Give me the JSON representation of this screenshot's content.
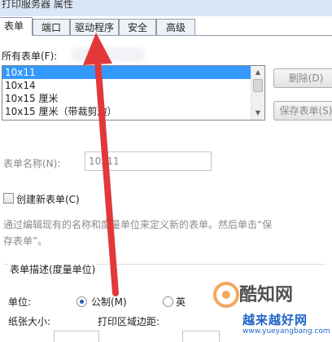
{
  "window": {
    "title": "打印服务器 属性"
  },
  "tabs": [
    {
      "label": "表单",
      "active": true
    },
    {
      "label": "端口"
    },
    {
      "label": "驱动程序"
    },
    {
      "label": "安全"
    },
    {
      "label": "高级"
    }
  ],
  "forms": {
    "list_label": "所有表单(F):",
    "items": [
      {
        "label": "10x11",
        "selected": true
      },
      {
        "label": "10x14"
      },
      {
        "label": "10x15 厘米"
      },
      {
        "label": "10x15 厘米（带裁剪边）"
      }
    ],
    "delete_button": "删除(D)",
    "save_button": "保存表单(S)"
  },
  "form_name": {
    "label": "表单名称(N):",
    "value": "10x11"
  },
  "create_new": {
    "label": "创建新表单(C)",
    "checked": false
  },
  "description": "通过编辑现有的名称和度量单位来定义新的表单。然后单击“保存表单”。",
  "measurements": {
    "title": "表单描述(度量单位)",
    "units_label": "单位:",
    "metric_label": "公制(M)",
    "english_label": "英",
    "paper_size_label": "纸张大小:",
    "margins_label": "打印区域边距:"
  },
  "watermarks": {
    "site1": "酷知网",
    "site2": "越来越好网",
    "site2_url": "www.yueyangbang.com"
  },
  "colors": {
    "selection": "#3399ff",
    "arrow": "#e3383a",
    "accent": "#1c5cb8"
  }
}
